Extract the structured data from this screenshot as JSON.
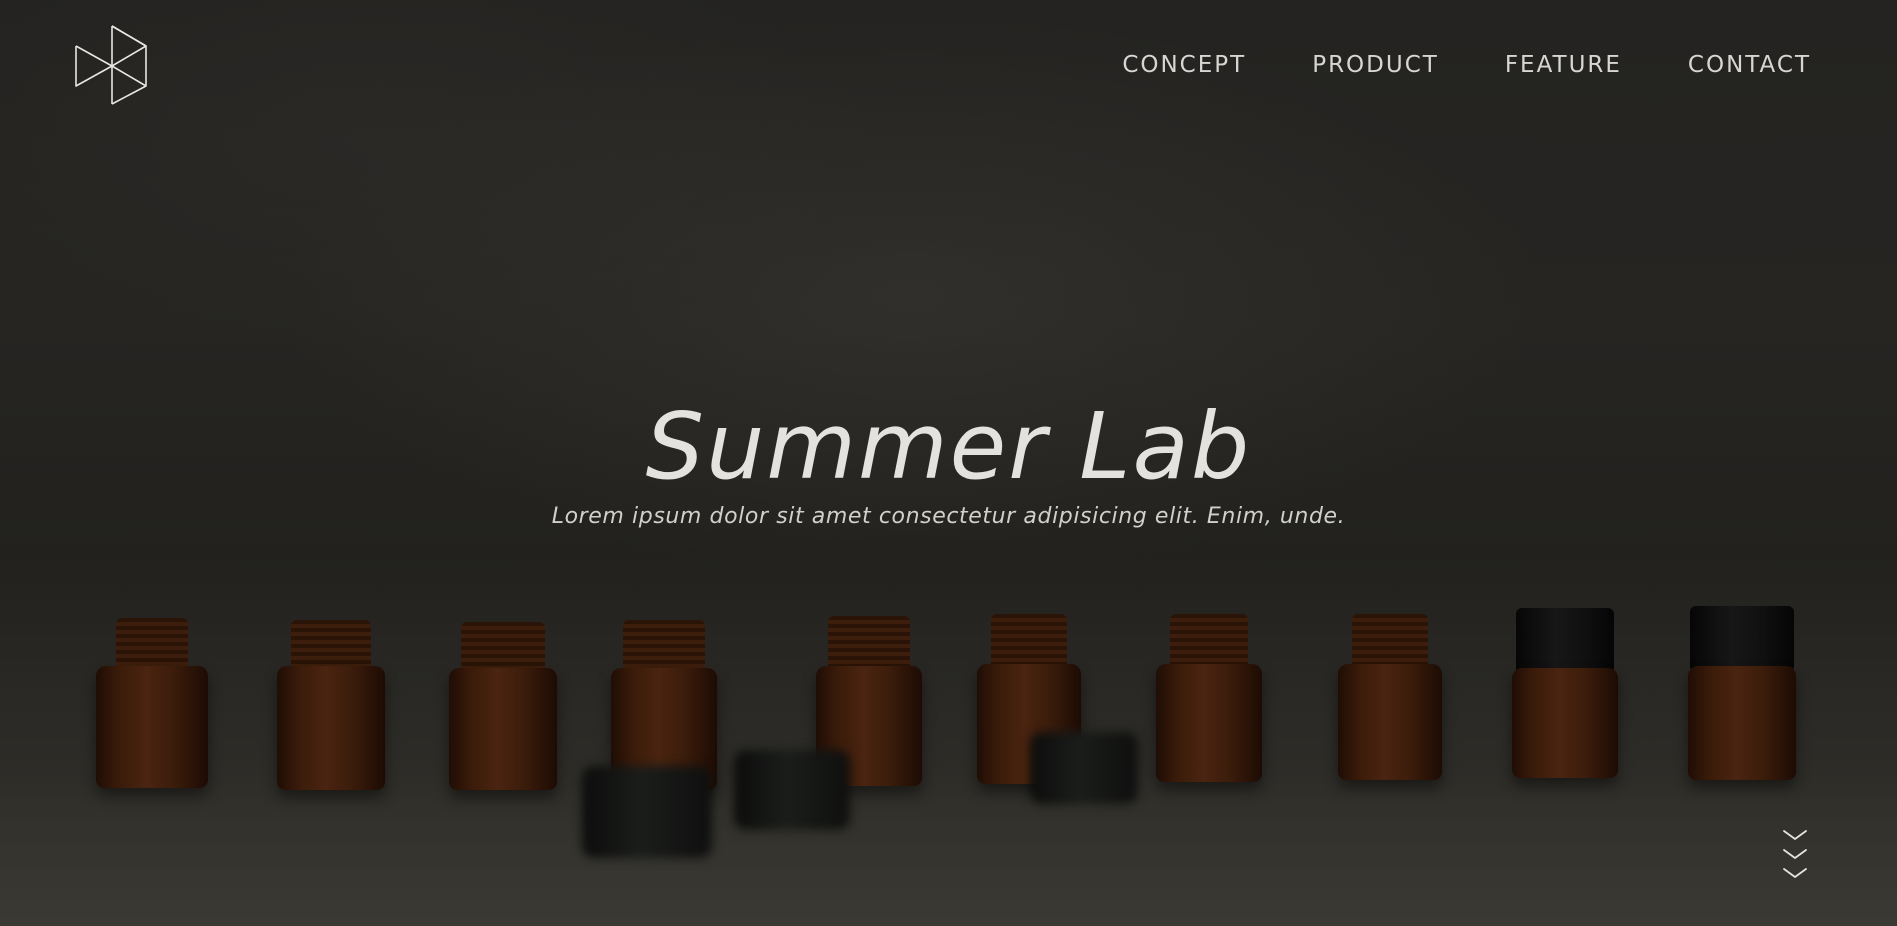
{
  "logo": {
    "icon": "hexagon-triangles-logo-icon"
  },
  "nav": {
    "items": [
      {
        "label": "CONCEPT"
      },
      {
        "label": "PRODUCT"
      },
      {
        "label": "FEATURE"
      },
      {
        "label": "CONTACT"
      }
    ]
  },
  "hero": {
    "title": "Summer Lab",
    "subtitle": "Lorem ipsum dolor sit amet consectetur adipisicing elit. Enim, unde."
  },
  "scroll": {
    "icon": "triple-chevron-down-icon"
  },
  "colors": {
    "background": "#242321",
    "text": "#e4e2de",
    "amber_glass": "#4a2410",
    "cap_black": "#0d0d0d"
  }
}
